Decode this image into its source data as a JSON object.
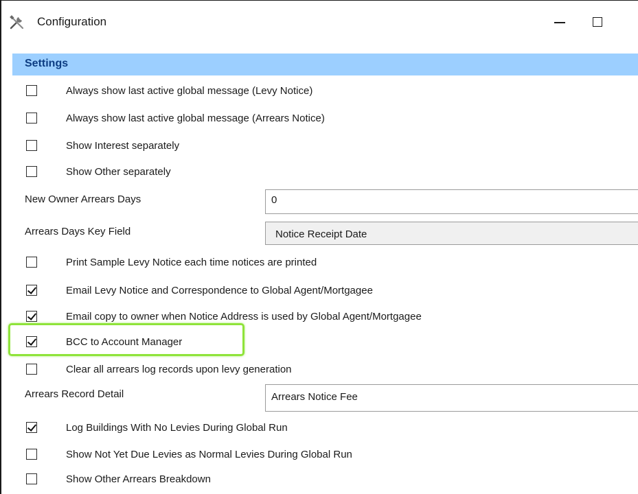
{
  "window": {
    "title": "Configuration",
    "icon": "tools-icon",
    "minimize_label": "—",
    "maximize_label": "☐"
  },
  "section": {
    "title": "Settings",
    "header_color": "#9ccfff",
    "title_color": "#0d3d82"
  },
  "settings": [
    {
      "label": "Always show last active global message (Levy Notice)",
      "checked": false
    },
    {
      "label": "Always show last active global message (Arrears Notice)",
      "checked": false
    },
    {
      "label": "Show Interest separately",
      "checked": false
    },
    {
      "label": "Show Other separately",
      "checked": false
    },
    {
      "label": "Print Sample Levy Notice each time notices are printed",
      "checked": false
    },
    {
      "label": "Email Levy Notice and Correspondence to Global Agent/Mortgagee",
      "checked": true
    },
    {
      "label": "Email copy to owner when Notice Address is used by Global Agent/Mortgagee",
      "checked": true
    },
    {
      "label": "BCC to Account Manager",
      "checked": true,
      "highlighted": true
    },
    {
      "label": "Clear all arrears log records upon levy generation",
      "checked": false
    },
    {
      "label": "Log Buildings With No Levies During Global Run",
      "checked": true
    },
    {
      "label": "Show Not Yet Due Levies as Normal Levies During Global Run",
      "checked": false
    },
    {
      "label": "Show Other Arrears Breakdown",
      "checked": false
    }
  ],
  "fields": {
    "new_owner_arrears_days": {
      "label": "New Owner Arrears Days",
      "value": "0"
    },
    "arrears_days_key_field": {
      "label": "Arrears Days Key Field",
      "value": "Notice Receipt Date"
    },
    "arrears_record_detail": {
      "label": "Arrears Record Detail",
      "value": "Arrears Notice Fee"
    }
  },
  "highlight_color": "#8fe33a"
}
